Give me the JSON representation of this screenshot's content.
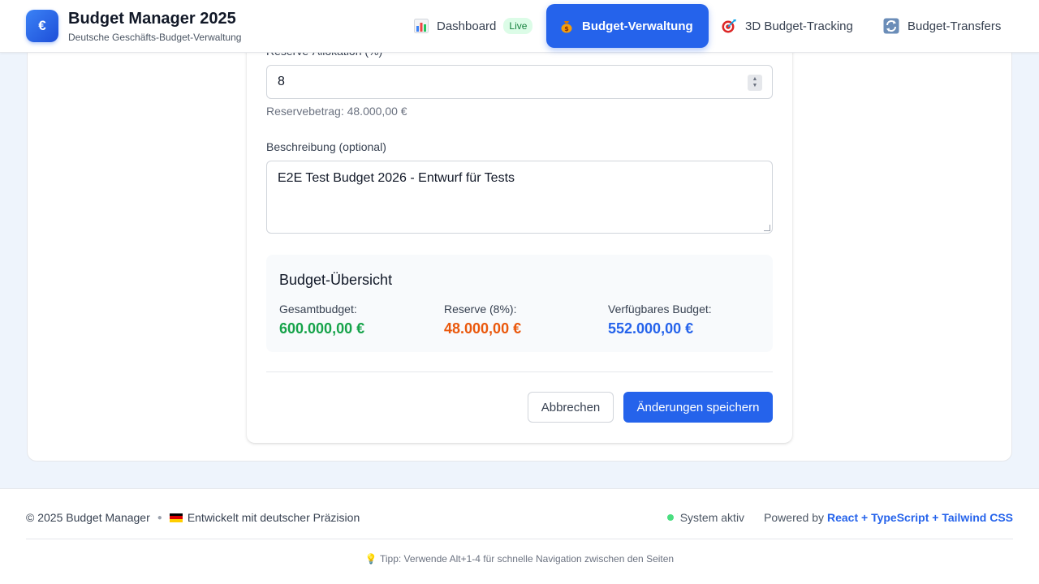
{
  "header": {
    "logo_symbol": "€",
    "title": "Budget Manager 2025",
    "subtitle": "Deutsche Geschäfts-Budget-Verwaltung",
    "nav": [
      {
        "label": "Dashboard",
        "icon": "bar-chart-icon",
        "badge": "Live",
        "active": false
      },
      {
        "label": "Budget-Verwaltung",
        "icon": "money-bag-icon",
        "active": true
      },
      {
        "label": "3D Budget-Tracking",
        "icon": "target-icon",
        "active": false
      },
      {
        "label": "Budget-Transfers",
        "icon": "transfer-icon",
        "active": false
      }
    ]
  },
  "form": {
    "reserve_label": "Reserve-Allokation (%)",
    "reserve_value": "8",
    "reserve_hint": "Reservebetrag: 48.000,00 €",
    "description_label": "Beschreibung (optional)",
    "description_value": "E2E Test Budget 2026 - Entwurf für Tests",
    "summary": {
      "title": "Budget-Übersicht",
      "total_label": "Gesamtbudget:",
      "total_value": "600.000,00 €",
      "reserve_label": "Reserve (8%):",
      "reserve_value": "48.000,00 €",
      "available_label": "Verfügbares Budget:",
      "available_value": "552.000,00 €"
    },
    "cancel_label": "Abbrechen",
    "save_label": "Änderungen speichern"
  },
  "colors": {
    "primary": "#2563eb",
    "total": "#16a34a",
    "reserve": "#ea580c",
    "available": "#2563eb"
  },
  "footer": {
    "copyright": "© 2025 Budget Manager",
    "made_with": "Entwickelt mit deutscher Präzision",
    "status": "System aktiv",
    "powered_prefix": "Powered by",
    "powered_tech": "React + TypeScript + Tailwind CSS",
    "tip": "Tipp: Verwende Alt+1-4 für schnelle Navigation zwischen den Seiten"
  }
}
